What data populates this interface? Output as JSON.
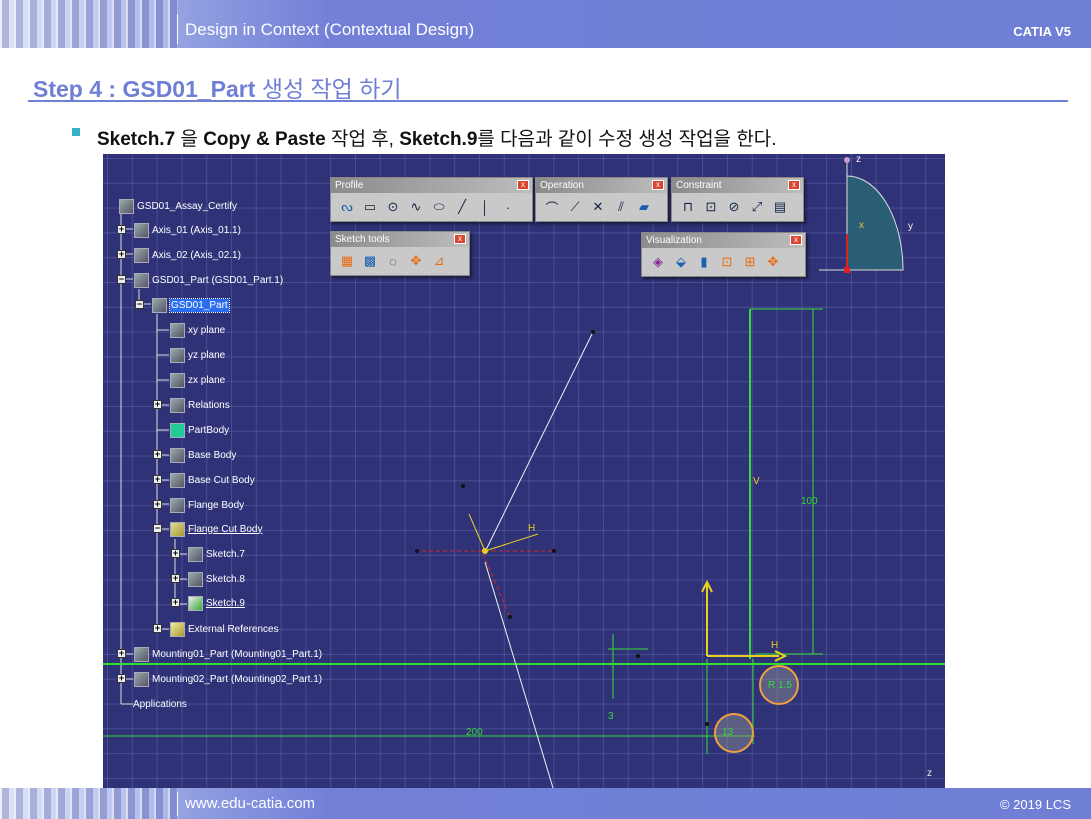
{
  "header": {
    "title": "Design in Context (Contextual Design)",
    "product": "CATIA V5"
  },
  "step": {
    "title_en": "Step 4 : GSD01_Part",
    "title_kr": "생성 작업 하기"
  },
  "instruction": {
    "a": "Sketch.7",
    "b": " 을 ",
    "c": "Copy & Paste",
    "d": " 작업 후, ",
    "e": "Sketch.9",
    "f": "를 다음과 같이 수정 생성 작업을 한다."
  },
  "tree": [
    {
      "label": "GSD01_Assay_Certify"
    },
    {
      "label": "Axis_01 (Axis_01.1)"
    },
    {
      "label": "Axis_02 (Axis_02.1)"
    },
    {
      "label": "GSD01_Part (GSD01_Part.1)"
    },
    {
      "label": "GSD01_Part"
    },
    {
      "label": "xy plane"
    },
    {
      "label": "yz plane"
    },
    {
      "label": "zx plane"
    },
    {
      "label": "Relations"
    },
    {
      "label": "PartBody"
    },
    {
      "label": "Base Body"
    },
    {
      "label": "Base Cut Body"
    },
    {
      "label": "Flange Body"
    },
    {
      "label": "Flange Cut Body"
    },
    {
      "label": "Sketch.7"
    },
    {
      "label": "Sketch.8"
    },
    {
      "label": "Sketch.9"
    },
    {
      "label": "External References"
    },
    {
      "label": "Mounting01_Part (Mounting01_Part.1)"
    },
    {
      "label": "Mounting02_Part (Mounting02_Part.1)"
    },
    {
      "label": "Applications"
    }
  ],
  "toolbars": {
    "profile": "Profile",
    "operation": "Operation",
    "constraint": "Constraint",
    "sketch_tools": "Sketch tools",
    "visualization": "Visualization"
  },
  "sketch": {
    "dim_100": "100",
    "dim_200": "200",
    "dim_3": "3",
    "dim_r15": "R 1.5",
    "dim_13": "13",
    "axis_h": "H",
    "axis_v": "V",
    "axis_h2": "H",
    "compass_z": "z",
    "compass_y": "y",
    "compass_x": "x",
    "corner_z": "z"
  },
  "colors": {
    "viewport_bg": "#2f3277",
    "accent": "#6f7fd6",
    "geometry_green": "#33dd33",
    "axis_yellow": "#e8d020",
    "highlight_circle": "#f0a040"
  },
  "footer": {
    "url": "www.edu-catia.com",
    "copyright": "© 2019 LCS"
  }
}
